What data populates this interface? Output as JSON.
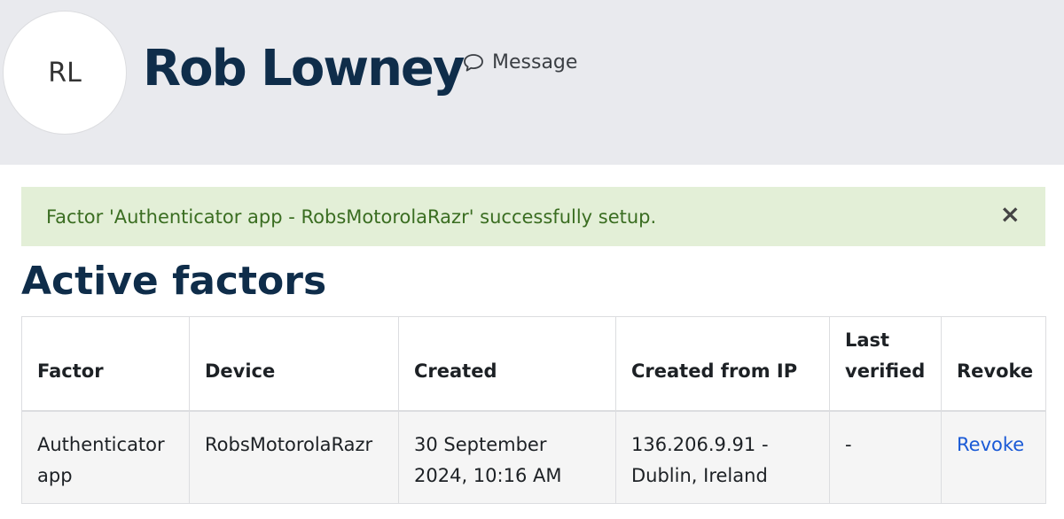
{
  "profile": {
    "initials": "RL",
    "name": "Rob Lowney",
    "message_label": "Message"
  },
  "alert": {
    "text": "Factor 'Authenticator app - RobsMotorolaRazr' successfully setup.",
    "close_symbol": "×",
    "color": "#e3efd7"
  },
  "section": {
    "title": "Active factors"
  },
  "table": {
    "headers": [
      "Factor",
      "Device",
      "Created",
      "Created from IP",
      "Last verified",
      "Revoke"
    ],
    "rows": [
      {
        "factor": "Authenticator app",
        "device": "RobsMotorolaRazr",
        "created": "30 September 2024, 10:16 AM",
        "created_from_ip": "136.206.9.91 - Dublin, Ireland",
        "last_verified": "-",
        "revoke": "Revoke"
      }
    ]
  },
  "colors": {
    "header_bg": "#e9eaee",
    "title": "#0f2d4a",
    "link": "#1a5ad6"
  },
  "icons": {
    "message": "speech-bubble-icon",
    "close": "close-icon"
  }
}
